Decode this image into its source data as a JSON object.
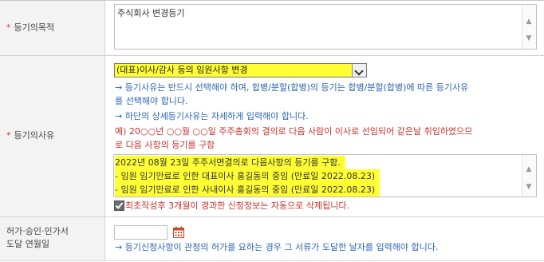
{
  "purpose": {
    "label": "등기의목적",
    "value": "주식회사 변경등기"
  },
  "reason": {
    "label": "등기의사유",
    "select_value": "(대표)이사/감사 등의 임원사항 변경",
    "notes": [
      "→ 등기사유는 반드시 선택해야 하며, 합병/분할(합병)의 등기는 합병/분할(합병)에 따른 등기사유",
      "를 선택해야 합니다.",
      "→ 하단의 상세등기사유는 자세하게 입력해야 합니다."
    ],
    "example_lines": [
      "예) 20○○년 ○○월 ○○일 주주총회의 결의로 다음 사람이 이사로 선임되어 같은날 취임하였으므",
      "로 다음 사항의 등기를 구함"
    ],
    "detail_lines": [
      "2022년 08월 23일 주주서면결의로 다음사항의 등기를 구함.",
      "- 임원 임기만료로 인한 대표이사 홍길동의 중임 (만료일 2022.08.23)",
      "- 임원 임기만료로 인한 사내이사 홍길동의 중임 (만료일 2022.08.23)"
    ],
    "auto_delete_text": "최초작성후 3개월이 경과한 신청정보는 자동으로 삭제됩니다."
  },
  "approval": {
    "label_line1": "허가·승인·인가서",
    "label_line2": "도달 연월일",
    "date_value": "",
    "note": "→ 등기신청사항이 관청의 허가를 요하는 경우 그 서류가 도달한 날자를 입력해야 합니다."
  },
  "icons": {
    "required": "asterisk",
    "scroll_up": "caret-up",
    "scroll_down": "caret-down",
    "dropdown": "chevron-down",
    "checkbox": "check",
    "calendar": "calendar"
  },
  "colors": {
    "highlight": "#ffff33",
    "required": "#dd3333",
    "note_blue": "#2a65b5",
    "note_red": "#c6322b",
    "label_bg": "#f3f3f3"
  }
}
